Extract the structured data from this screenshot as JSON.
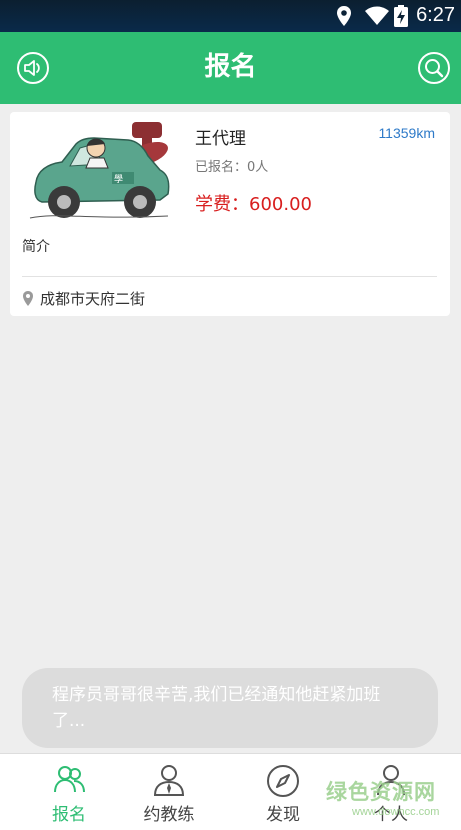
{
  "status_bar": {
    "time": "6:27"
  },
  "header": {
    "title": "报名"
  },
  "card": {
    "name": "王代理",
    "distance": "11359km",
    "enrolled": "已报名：0人",
    "fee": "学费：600.00",
    "intro": "简介",
    "address": "成都市天府二街"
  },
  "toast": {
    "message": "程序员哥哥很辛苦,我们已经通知他赶紧加班了..."
  },
  "tabs": [
    {
      "label": "报名",
      "active": true
    },
    {
      "label": "约教练"
    },
    {
      "label": "发现"
    },
    {
      "label": "个人"
    }
  ],
  "watermark": {
    "main": "绿色资源网",
    "sub": "www.downcc.com"
  },
  "colors": {
    "primary": "#2ebd73",
    "fee": "#d81e1e",
    "distance": "#2e7ac8"
  }
}
